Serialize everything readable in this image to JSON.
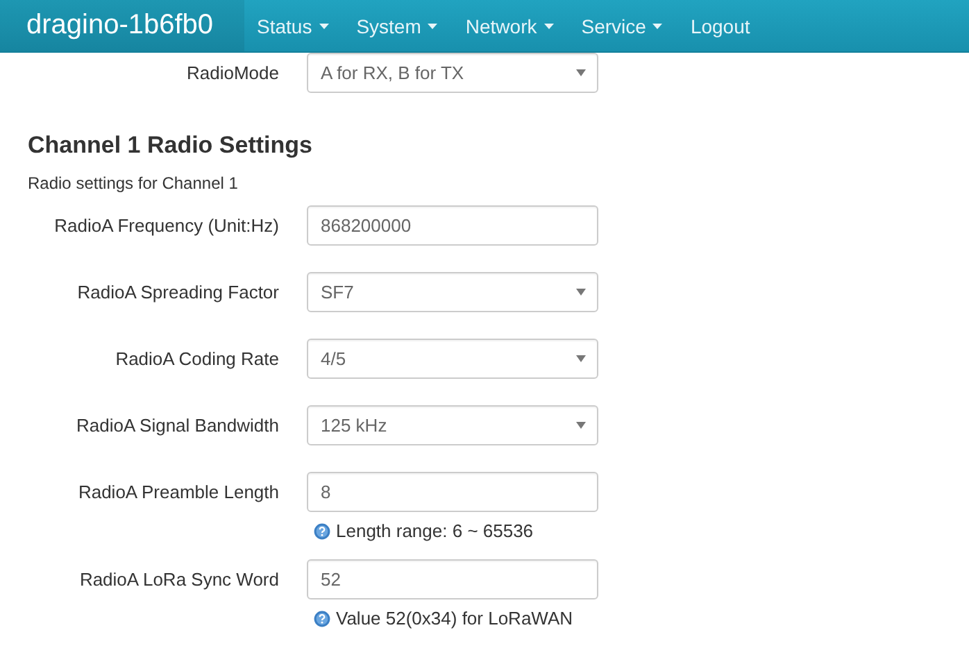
{
  "navbar": {
    "brand": "dragino-1b6fb0",
    "menu": [
      {
        "label": "Status",
        "dropdown": true
      },
      {
        "label": "System",
        "dropdown": true
      },
      {
        "label": "Network",
        "dropdown": true
      },
      {
        "label": "Service",
        "dropdown": true
      },
      {
        "label": "Logout",
        "dropdown": false
      }
    ]
  },
  "top_field": {
    "label": "RadioMode",
    "kind": "select",
    "value": "A for RX, B for TX"
  },
  "section": {
    "title": "Channel 1 Radio Settings",
    "description": "Radio settings for Channel 1",
    "fields": [
      {
        "label": "RadioA Frequency (Unit:Hz)",
        "kind": "text",
        "value": "868200000"
      },
      {
        "label": "RadioA Spreading Factor",
        "kind": "select",
        "value": "SF7"
      },
      {
        "label": "RadioA Coding Rate",
        "kind": "select",
        "value": "4/5"
      },
      {
        "label": "RadioA Signal Bandwidth",
        "kind": "select",
        "value": "125 kHz"
      },
      {
        "label": "RadioA Preamble Length",
        "kind": "text",
        "value": "8",
        "hint": "Length range: 6 ~ 65536"
      },
      {
        "label": "RadioA LoRa Sync Word",
        "kind": "text",
        "value": "52",
        "hint": "Value 52(0x34) for LoRaWAN"
      }
    ]
  }
}
